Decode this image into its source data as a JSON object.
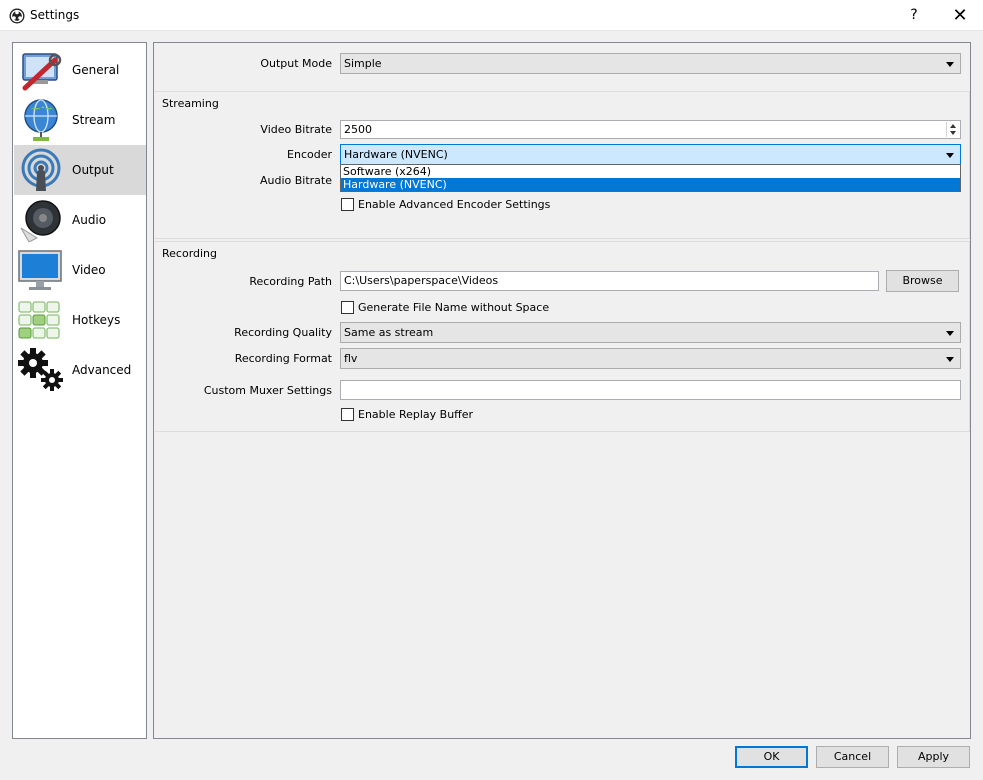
{
  "window": {
    "title": "Settings",
    "help_glyph": "?",
    "close_glyph": "✕"
  },
  "sidebar": {
    "items": [
      {
        "label": "General"
      },
      {
        "label": "Stream"
      },
      {
        "label": "Output"
      },
      {
        "label": "Audio"
      },
      {
        "label": "Video"
      },
      {
        "label": "Hotkeys"
      },
      {
        "label": "Advanced"
      }
    ],
    "active_index": 2
  },
  "output": {
    "output_mode_label": "Output Mode",
    "output_mode_value": "Simple",
    "streaming": {
      "title": "Streaming",
      "video_bitrate_label": "Video Bitrate",
      "video_bitrate_value": "2500",
      "encoder_label": "Encoder",
      "encoder_value": "Hardware (NVENC)",
      "encoder_options": [
        "Software (x264)",
        "Hardware (NVENC)"
      ],
      "encoder_selected_index": 1,
      "audio_bitrate_label": "Audio Bitrate",
      "advanced_encoder_label": "Enable Advanced Encoder Settings",
      "advanced_encoder_checked": false
    },
    "recording": {
      "title": "Recording",
      "path_label": "Recording Path",
      "path_value": "C:\\Users\\paperspace\\Videos",
      "browse_label": "Browse",
      "no_space_label": "Generate File Name without Space",
      "no_space_checked": false,
      "quality_label": "Recording Quality",
      "quality_value": "Same as stream",
      "format_label": "Recording Format",
      "format_value": "flv",
      "muxer_label": "Custom Muxer Settings",
      "muxer_value": "",
      "replay_label": "Enable Replay Buffer",
      "replay_checked": false
    }
  },
  "footer": {
    "ok_label": "OK",
    "cancel_label": "Cancel",
    "apply_label": "Apply"
  }
}
